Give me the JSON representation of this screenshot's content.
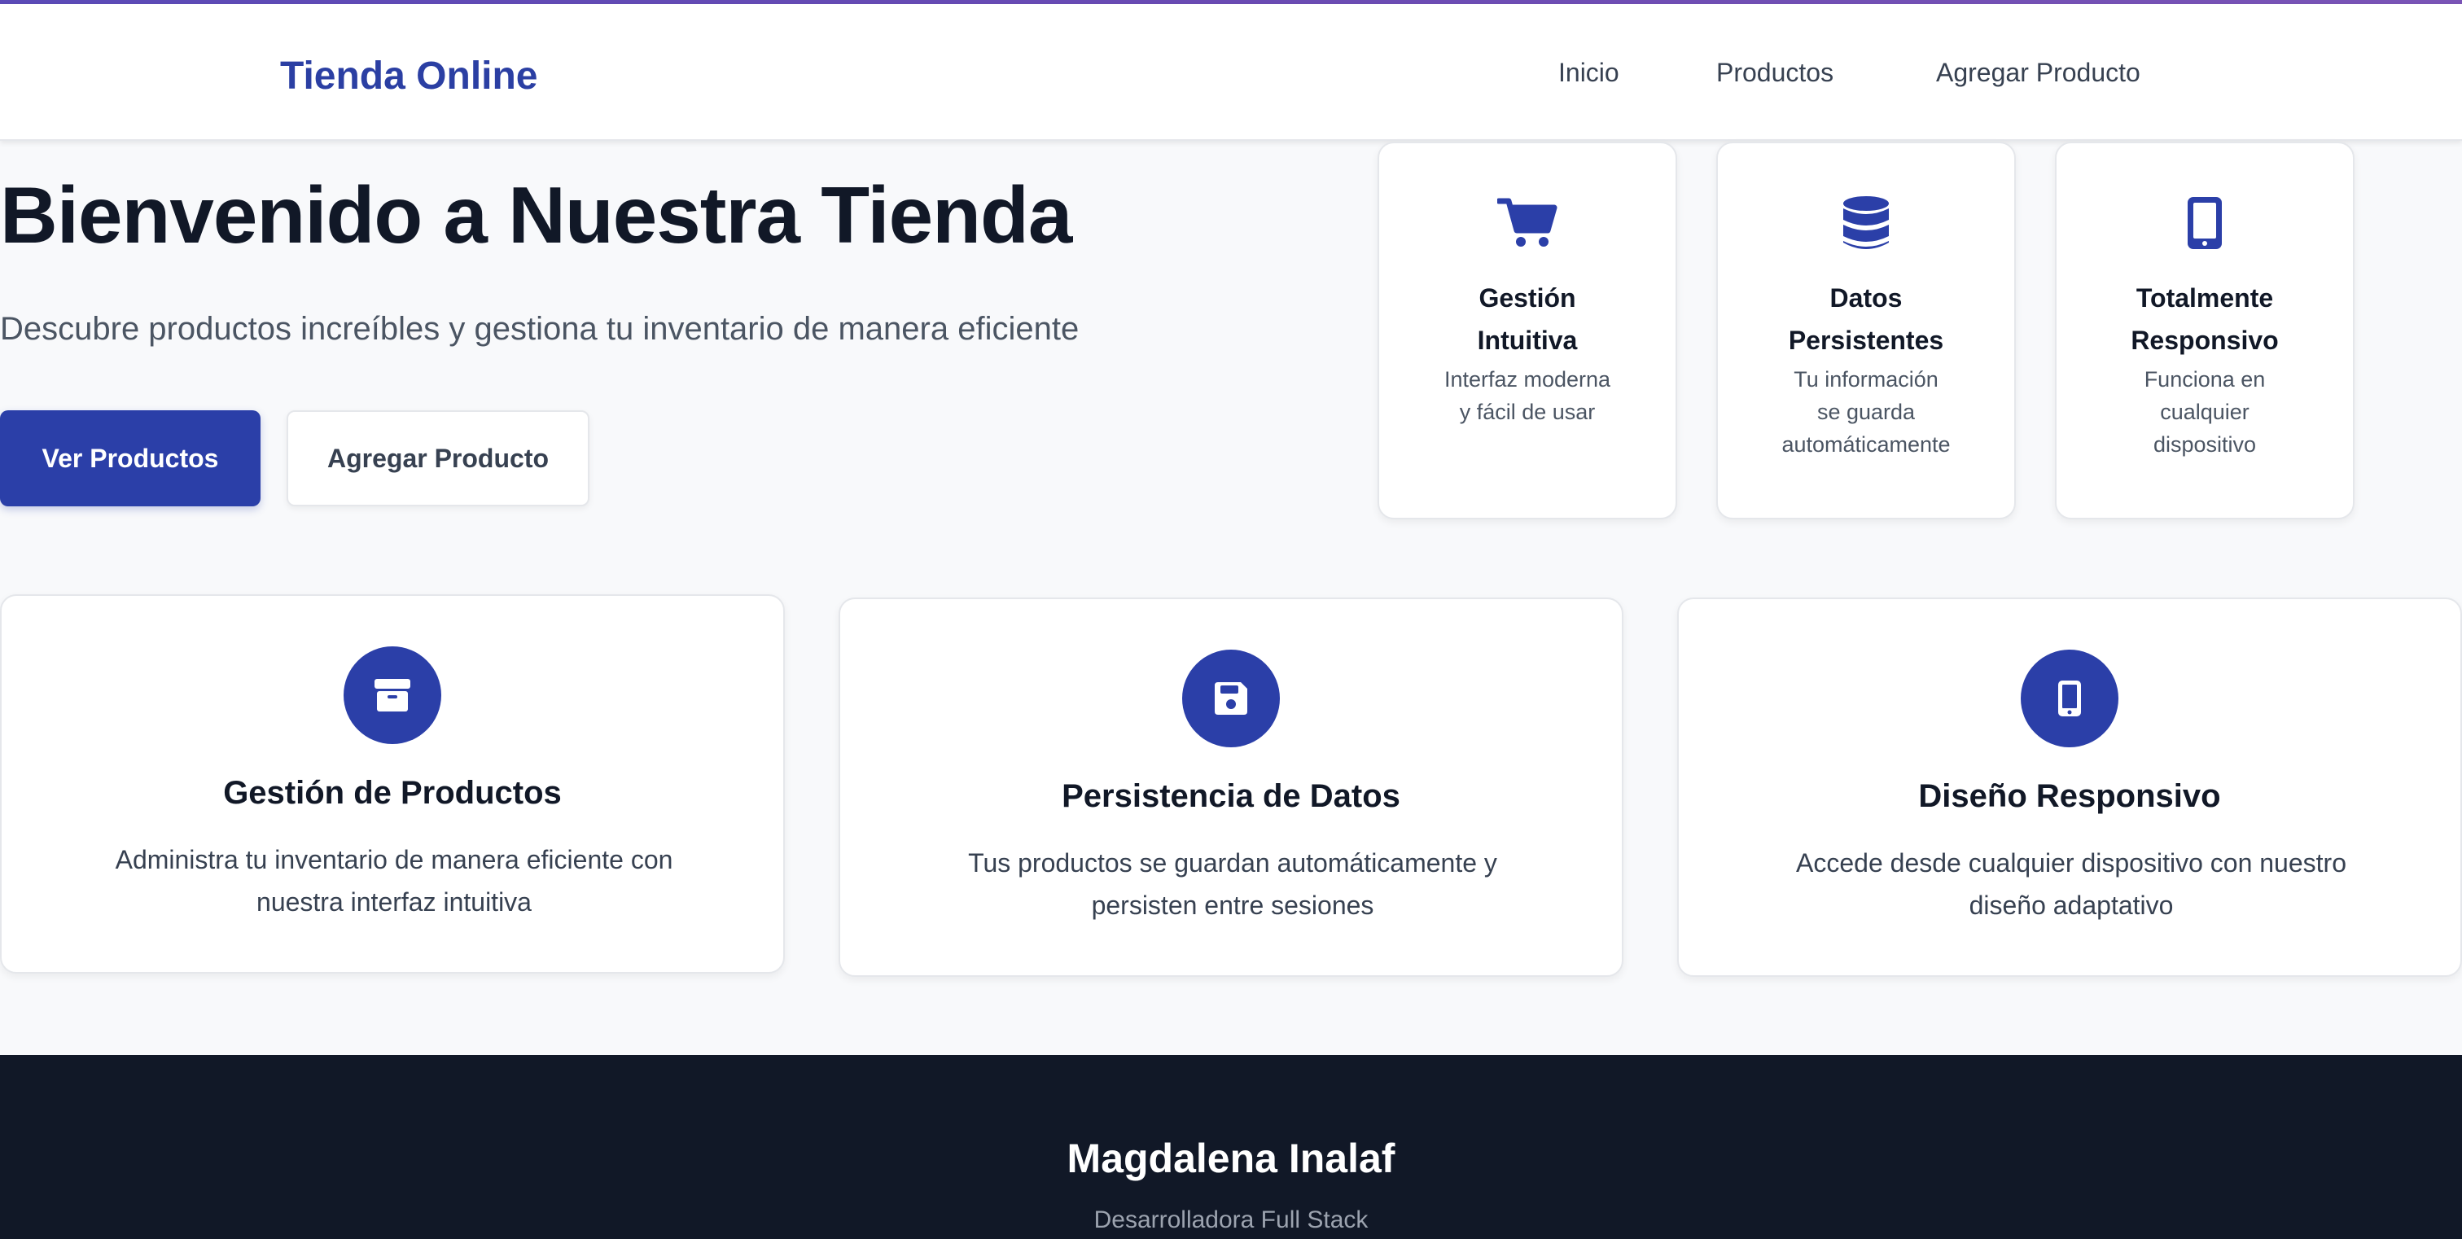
{
  "nav": {
    "brand": "Tienda Online",
    "links": [
      "Inicio",
      "Productos",
      "Agregar Producto"
    ]
  },
  "hero": {
    "title": "Bienvenido a Nuestra Tienda",
    "subtitle": "Descubre productos increíbles y gestiona tu inventario de manera eficiente",
    "primary_button": "Ver Productos",
    "secondary_button": "Agregar Producto"
  },
  "mini_cards": [
    {
      "icon": "shopping-cart-icon",
      "title_line1": "Gestión",
      "title_line2": "Intuitiva",
      "desc_line1": "Interfaz moderna",
      "desc_line2": "y fácil de usar",
      "desc_line3": ""
    },
    {
      "icon": "database-icon",
      "title_line1": "Datos",
      "title_line2": "Persistentes",
      "desc_line1": "Tu información",
      "desc_line2": "se guarda",
      "desc_line3": "automáticamente"
    },
    {
      "icon": "mobile-phone-icon",
      "title_line1": "Totalmente",
      "title_line2": "Responsivo",
      "desc_line1": "Funciona en",
      "desc_line2": "cualquier",
      "desc_line3": "dispositivo"
    }
  ],
  "features": [
    {
      "icon": "box-icon",
      "title": "Gestión de Productos",
      "desc_line1": "Administra tu inventario de manera eficiente con",
      "desc_line2": "nuestra interfaz intuitiva"
    },
    {
      "icon": "floppy-disk-icon",
      "title": "Persistencia de Datos",
      "desc_line1": "Tus productos se guardan automáticamente y",
      "desc_line2": "persisten entre sesiones"
    },
    {
      "icon": "mobile-phone-icon",
      "title": "Diseño Responsivo",
      "desc_line1": "Accede desde cualquier dispositivo con nuestro",
      "desc_line2": "diseño adaptativo"
    }
  ],
  "footer": {
    "name": "Magdalena Inalaf",
    "role": "Desarrolladora Full Stack"
  },
  "colors": {
    "brand": "#2b3fa3",
    "primary": "#2b3fa8",
    "footer_bg": "#111827"
  }
}
